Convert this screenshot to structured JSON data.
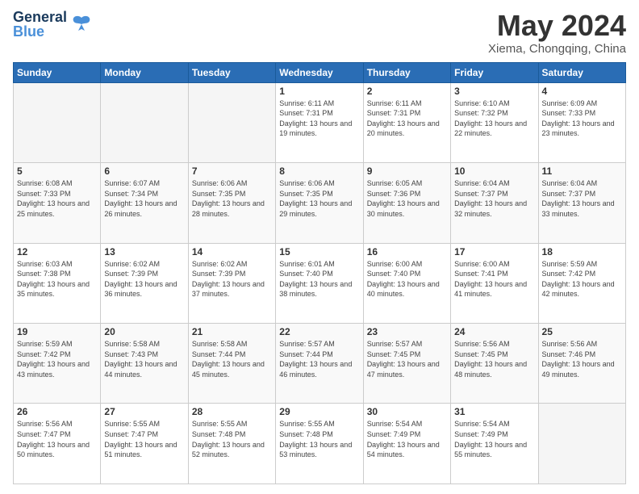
{
  "logo": {
    "part1": "General",
    "part2": "Blue"
  },
  "header": {
    "month": "May 2024",
    "location": "Xiema, Chongqing, China"
  },
  "weekdays": [
    "Sunday",
    "Monday",
    "Tuesday",
    "Wednesday",
    "Thursday",
    "Friday",
    "Saturday"
  ],
  "weeks": [
    [
      {
        "day": "",
        "empty": true
      },
      {
        "day": "",
        "empty": true
      },
      {
        "day": "",
        "empty": true
      },
      {
        "day": "1",
        "sunrise": "6:11 AM",
        "sunset": "7:31 PM",
        "daylight": "13 hours and 19 minutes."
      },
      {
        "day": "2",
        "sunrise": "6:11 AM",
        "sunset": "7:31 PM",
        "daylight": "13 hours and 20 minutes."
      },
      {
        "day": "3",
        "sunrise": "6:10 AM",
        "sunset": "7:32 PM",
        "daylight": "13 hours and 22 minutes."
      },
      {
        "day": "4",
        "sunrise": "6:09 AM",
        "sunset": "7:33 PM",
        "daylight": "13 hours and 23 minutes."
      }
    ],
    [
      {
        "day": "5",
        "sunrise": "6:08 AM",
        "sunset": "7:33 PM",
        "daylight": "13 hours and 25 minutes."
      },
      {
        "day": "6",
        "sunrise": "6:07 AM",
        "sunset": "7:34 PM",
        "daylight": "13 hours and 26 minutes."
      },
      {
        "day": "7",
        "sunrise": "6:06 AM",
        "sunset": "7:35 PM",
        "daylight": "13 hours and 28 minutes."
      },
      {
        "day": "8",
        "sunrise": "6:06 AM",
        "sunset": "7:35 PM",
        "daylight": "13 hours and 29 minutes."
      },
      {
        "day": "9",
        "sunrise": "6:05 AM",
        "sunset": "7:36 PM",
        "daylight": "13 hours and 30 minutes."
      },
      {
        "day": "10",
        "sunrise": "6:04 AM",
        "sunset": "7:37 PM",
        "daylight": "13 hours and 32 minutes."
      },
      {
        "day": "11",
        "sunrise": "6:04 AM",
        "sunset": "7:37 PM",
        "daylight": "13 hours and 33 minutes."
      }
    ],
    [
      {
        "day": "12",
        "sunrise": "6:03 AM",
        "sunset": "7:38 PM",
        "daylight": "13 hours and 35 minutes."
      },
      {
        "day": "13",
        "sunrise": "6:02 AM",
        "sunset": "7:39 PM",
        "daylight": "13 hours and 36 minutes."
      },
      {
        "day": "14",
        "sunrise": "6:02 AM",
        "sunset": "7:39 PM",
        "daylight": "13 hours and 37 minutes."
      },
      {
        "day": "15",
        "sunrise": "6:01 AM",
        "sunset": "7:40 PM",
        "daylight": "13 hours and 38 minutes."
      },
      {
        "day": "16",
        "sunrise": "6:00 AM",
        "sunset": "7:40 PM",
        "daylight": "13 hours and 40 minutes."
      },
      {
        "day": "17",
        "sunrise": "6:00 AM",
        "sunset": "7:41 PM",
        "daylight": "13 hours and 41 minutes."
      },
      {
        "day": "18",
        "sunrise": "5:59 AM",
        "sunset": "7:42 PM",
        "daylight": "13 hours and 42 minutes."
      }
    ],
    [
      {
        "day": "19",
        "sunrise": "5:59 AM",
        "sunset": "7:42 PM",
        "daylight": "13 hours and 43 minutes."
      },
      {
        "day": "20",
        "sunrise": "5:58 AM",
        "sunset": "7:43 PM",
        "daylight": "13 hours and 44 minutes."
      },
      {
        "day": "21",
        "sunrise": "5:58 AM",
        "sunset": "7:44 PM",
        "daylight": "13 hours and 45 minutes."
      },
      {
        "day": "22",
        "sunrise": "5:57 AM",
        "sunset": "7:44 PM",
        "daylight": "13 hours and 46 minutes."
      },
      {
        "day": "23",
        "sunrise": "5:57 AM",
        "sunset": "7:45 PM",
        "daylight": "13 hours and 47 minutes."
      },
      {
        "day": "24",
        "sunrise": "5:56 AM",
        "sunset": "7:45 PM",
        "daylight": "13 hours and 48 minutes."
      },
      {
        "day": "25",
        "sunrise": "5:56 AM",
        "sunset": "7:46 PM",
        "daylight": "13 hours and 49 minutes."
      }
    ],
    [
      {
        "day": "26",
        "sunrise": "5:56 AM",
        "sunset": "7:47 PM",
        "daylight": "13 hours and 50 minutes."
      },
      {
        "day": "27",
        "sunrise": "5:55 AM",
        "sunset": "7:47 PM",
        "daylight": "13 hours and 51 minutes."
      },
      {
        "day": "28",
        "sunrise": "5:55 AM",
        "sunset": "7:48 PM",
        "daylight": "13 hours and 52 minutes."
      },
      {
        "day": "29",
        "sunrise": "5:55 AM",
        "sunset": "7:48 PM",
        "daylight": "13 hours and 53 minutes."
      },
      {
        "day": "30",
        "sunrise": "5:54 AM",
        "sunset": "7:49 PM",
        "daylight": "13 hours and 54 minutes."
      },
      {
        "day": "31",
        "sunrise": "5:54 AM",
        "sunset": "7:49 PM",
        "daylight": "13 hours and 55 minutes."
      },
      {
        "day": "",
        "empty": true
      }
    ]
  ]
}
